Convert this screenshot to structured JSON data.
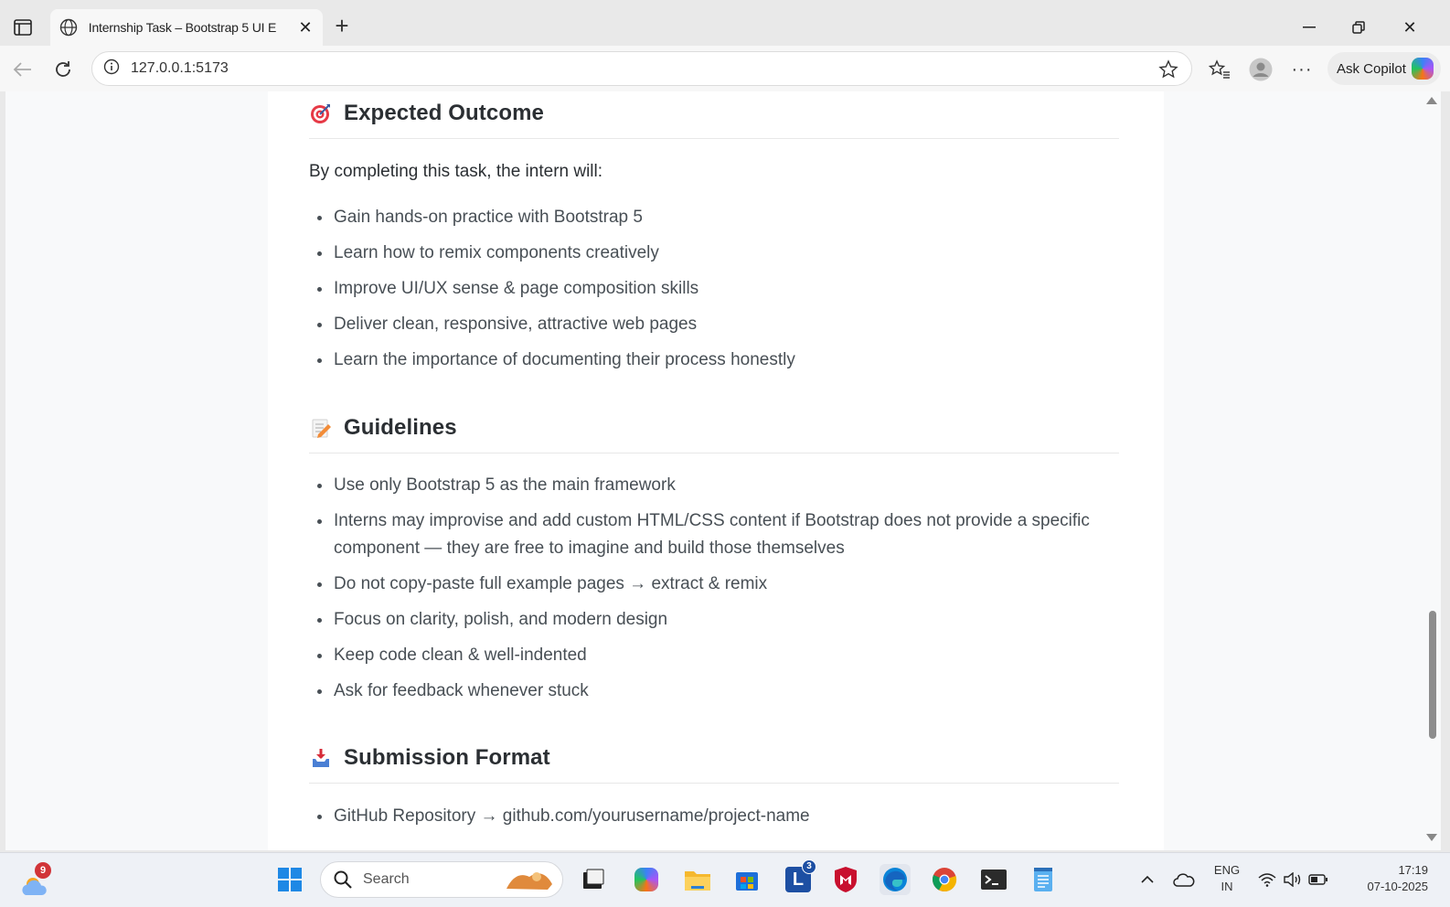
{
  "browser": {
    "tab_title": "Internship Task – Bootstrap 5 UI E",
    "url": "127.0.0.1:5173",
    "ask_copilot": "Ask Copilot"
  },
  "page": {
    "sections": [
      {
        "title": "Expected Outcome",
        "icon": "target-icon",
        "lead": "By completing this task, the intern will:",
        "items": [
          "Gain hands-on practice with Bootstrap 5",
          "Learn how to remix components creatively",
          "Improve UI/UX sense & page composition skills",
          "Deliver clean, responsive, attractive web pages",
          "Learn the importance of documenting their process honestly"
        ]
      },
      {
        "title": "Guidelines",
        "icon": "memo-icon",
        "items": [
          "Use only Bootstrap 5 as the main framework",
          "Interns may improvise and add custom HTML/CSS content if Bootstrap does not provide a specific component — they are free to imagine and build those themselves",
          "Do not copy-paste full example pages → extract & remix",
          "Focus on clarity, polish, and modern design",
          "Keep code clean & well-indented",
          "Ask for feedback whenever stuck"
        ]
      },
      {
        "title": "Submission Format",
        "icon": "inbox-tray-icon",
        "items": [
          "GitHub Repository → github.com/yourusername/project-name"
        ]
      }
    ]
  },
  "taskbar": {
    "weather_badge": "9",
    "search_label": "Search",
    "app_badge": "3",
    "lang_line1": "ENG",
    "lang_line2": "IN",
    "time": "17:19",
    "date": "07-10-2025"
  },
  "colors": {
    "heading": "#2b2f33",
    "body_text": "#484f55",
    "page_bg": "#f8f9fa"
  }
}
